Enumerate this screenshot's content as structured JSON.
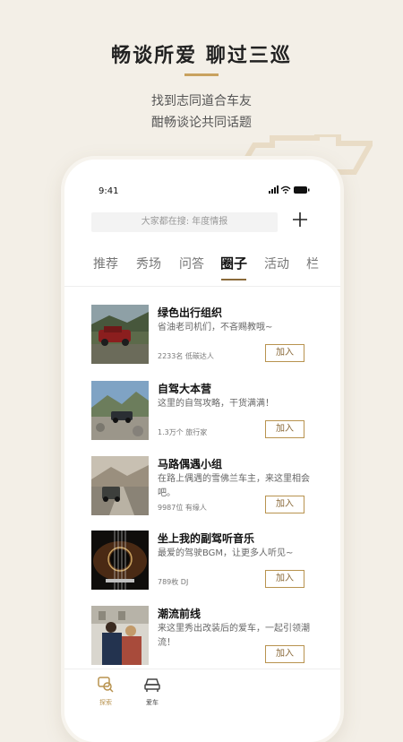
{
  "hero": {
    "title": "畅谈所爱 聊过三巡",
    "subtitle_line1": "找到志同道合车友",
    "subtitle_line2": "酣畅谈论共同话题"
  },
  "status_bar": {
    "time": "9:41"
  },
  "search": {
    "text": "大家都在搜:  年度情报"
  },
  "tabs": [
    {
      "label": "推荐"
    },
    {
      "label": "秀场"
    },
    {
      "label": "问答"
    },
    {
      "label": "圈子",
      "active": true
    },
    {
      "label": "活动"
    },
    {
      "label": "栏"
    }
  ],
  "groups": [
    {
      "name": "绿色出行组织",
      "desc": "省油老司机们，不吝赐教哦~",
      "meta": "2233名 低碳达人",
      "join_label": "加入"
    },
    {
      "name": "自驾大本营",
      "desc": "这里的自驾攻略，干货满满！",
      "meta": "1.3万个 旅行家",
      "join_label": "加入"
    },
    {
      "name": "马路偶遇小组",
      "desc": "在路上偶遇的雪佛兰车主，来这里相会吧。",
      "meta": "9987位 有缘人",
      "join_label": "加入"
    },
    {
      "name": "坐上我的副驾听音乐",
      "desc": "最爱的驾驶BGM，让更多人听见~",
      "meta": "789枚 DJ",
      "join_label": "加入"
    },
    {
      "name": "潮流前线",
      "desc": "来这里秀出改装后的爱车，一起引领潮流！",
      "meta": "",
      "join_label": "加入"
    }
  ],
  "bottom_nav": [
    {
      "label": "探索",
      "icon": "explore-icon",
      "active": true
    },
    {
      "label": "爱车",
      "icon": "car-icon",
      "active": false
    }
  ],
  "colors": {
    "accent": "#c9a25f",
    "accent_dark": "#8a6a3a",
    "background": "#f3efe7"
  }
}
